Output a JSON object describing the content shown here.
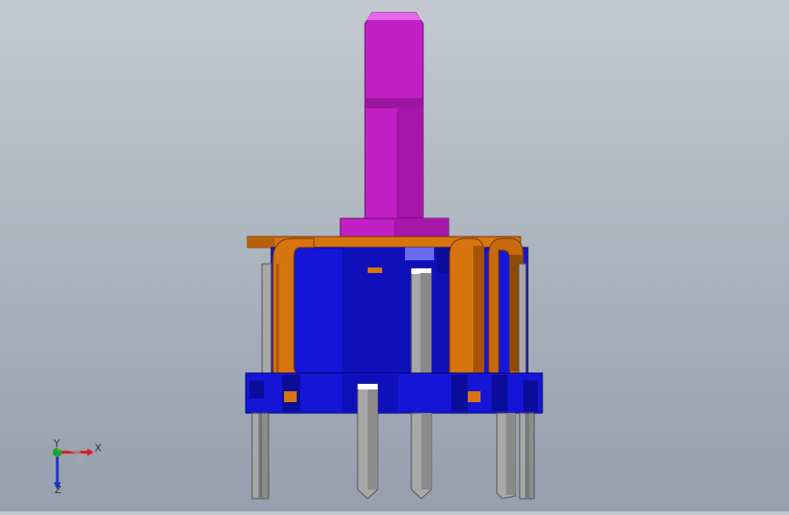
{
  "viewport": {
    "background_top": "#c4c9d1",
    "background_bottom": "#959fad"
  },
  "model": {
    "description_icon": "rotary-potentiometer-model",
    "colors": {
      "shaft": "#c21fc6",
      "shaft_shade": "#9a169e",
      "housing": "#1515d8",
      "housing_dark": "#0c0c9a",
      "terminal_copper": "#d8740d",
      "terminal_copper_dark": "#a65508",
      "pin": "#a8a8a8",
      "pin_dark": "#6e6e6e"
    }
  },
  "triad": {
    "x_label": "X",
    "y_label": "Y",
    "z_label": "Z",
    "x_color": "#d61b1b",
    "y_color": "#1fa32a",
    "z_color": "#1a2fd0"
  }
}
